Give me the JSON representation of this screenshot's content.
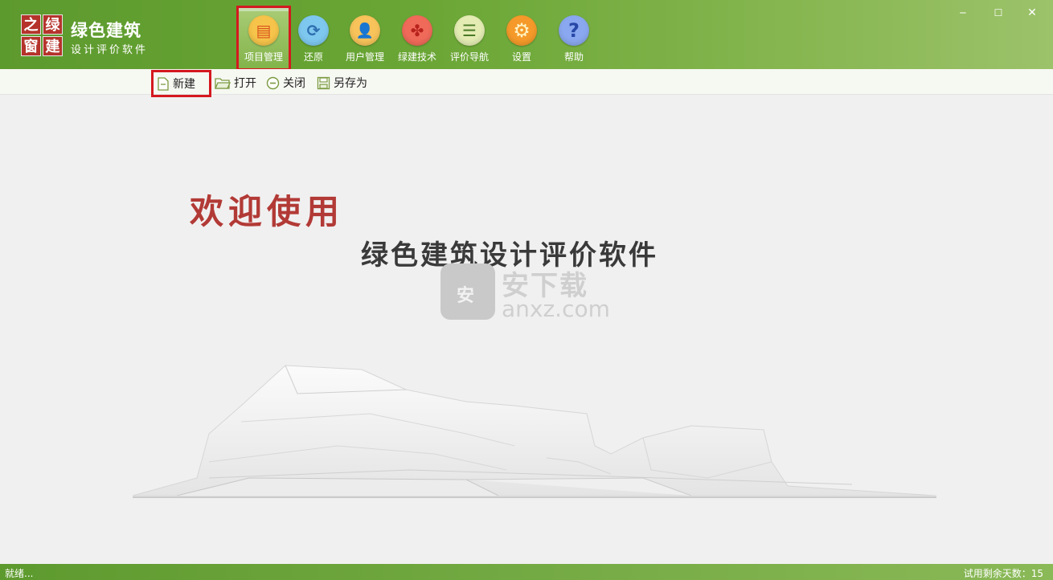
{
  "app": {
    "logo_chars": [
      "之",
      "绿",
      "窗",
      "建"
    ],
    "title": "绿色建筑",
    "subtitle": "设计评价软件"
  },
  "tabs": [
    {
      "label": "项目管理",
      "icon": "project-icon",
      "color": "#f6c44a",
      "glyph": "▤"
    },
    {
      "label": "还原",
      "icon": "restore-icon",
      "color": "#7ec8f0",
      "glyph": "⟳"
    },
    {
      "label": "用户管理",
      "icon": "user-icon",
      "color": "#f7c35a",
      "glyph": "👤"
    },
    {
      "label": "绿建技术",
      "icon": "tech-icon",
      "color": "#f06a5a",
      "glyph": "✤"
    },
    {
      "label": "评价导航",
      "icon": "book-icon",
      "color": "#e4ecb4",
      "glyph": "☰"
    },
    {
      "label": "设置",
      "icon": "gear-icon",
      "color": "#f59a2a",
      "glyph": "⚙"
    },
    {
      "label": "帮助",
      "icon": "help-icon",
      "color": "#8aa8f0",
      "glyph": "?"
    }
  ],
  "window_controls": {
    "minimize": "‒",
    "maximize": "☐",
    "close": "✕"
  },
  "toolbar": {
    "new_label": "新建",
    "open_label": "打开",
    "close_label": "关闭",
    "save_as_label": "另存为"
  },
  "content": {
    "welcome": "欢迎使用",
    "headline": "绿色建筑设计评价软件",
    "watermark_cn": "安下载",
    "watermark_en": "anxz.com",
    "watermark_badge": "安"
  },
  "status": {
    "left": "就绪...",
    "right": "试用剩余天数：15"
  },
  "colors": {
    "ribbon": "#6aa635",
    "accent_red": "#b23a36",
    "highlight": "#d4191f"
  }
}
